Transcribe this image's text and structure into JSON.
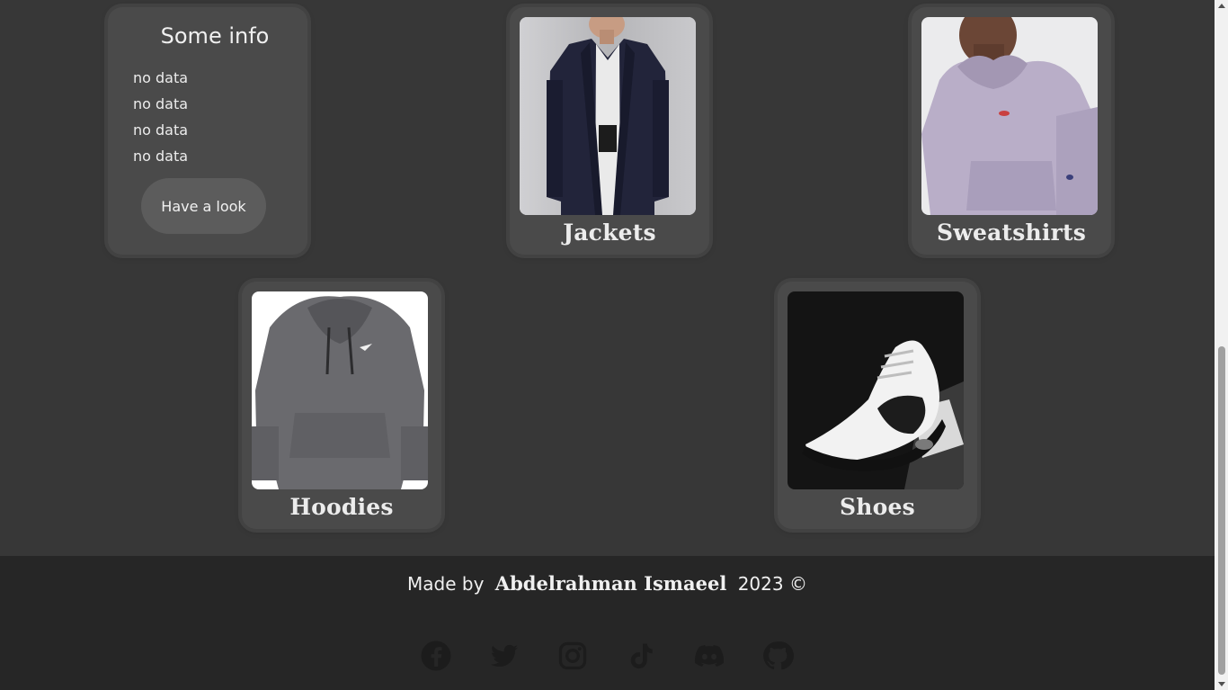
{
  "info_card": {
    "title": "Some info",
    "items": [
      "no data",
      "no data",
      "no data",
      "no data"
    ],
    "button_label": "Have a look"
  },
  "categories": [
    {
      "label": "Jackets",
      "image": "jacket-photo"
    },
    {
      "label": "Sweatshirts",
      "image": "sweatshirt-photo"
    },
    {
      "label": "Hoodies",
      "image": "hoodie-photo"
    },
    {
      "label": "Shoes",
      "image": "shoe-photo"
    }
  ],
  "footer": {
    "made_by": "Made by",
    "author": "Abdelrahman Ismaeel",
    "year_copyright": "2023 ©",
    "socials": [
      "facebook-icon",
      "twitter-icon",
      "instagram-icon",
      "tiktok-icon",
      "discord-icon",
      "github-icon"
    ]
  },
  "colors": {
    "background": "#373737",
    "card": "#4a4a4a",
    "footer": "#262626",
    "icon": "#1c1c1c"
  }
}
